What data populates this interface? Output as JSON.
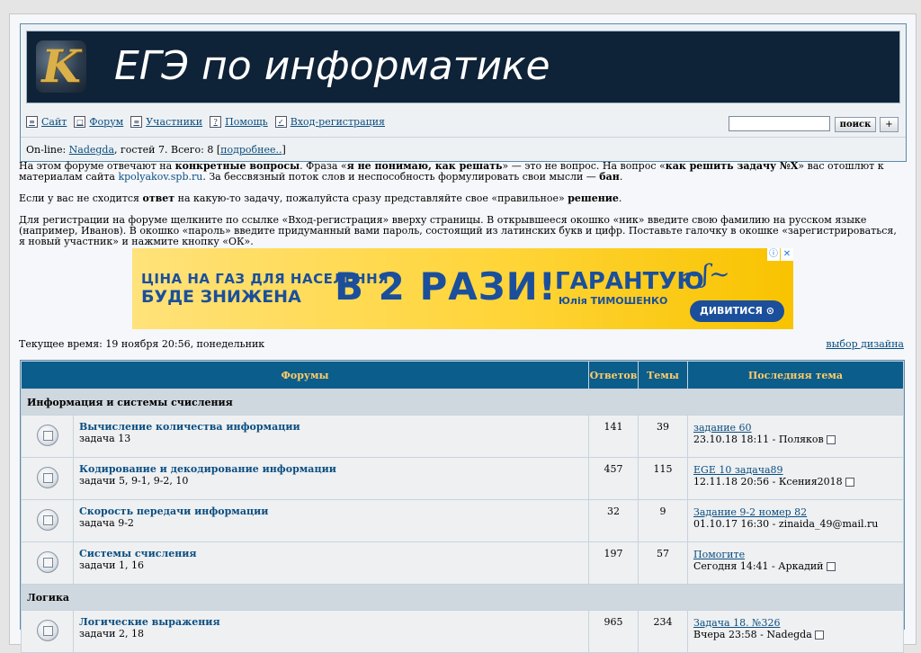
{
  "header": {
    "logo_letter": "K",
    "site_title": "ЕГЭ по информатике"
  },
  "nav": {
    "items": [
      {
        "label": "Сайт",
        "icon": "site-icon"
      },
      {
        "label": "Форум",
        "icon": "forum-icon"
      },
      {
        "label": "Участники",
        "icon": "members-icon"
      },
      {
        "label": "Помощь",
        "icon": "help-icon"
      },
      {
        "label": "Вход-регистрация",
        "icon": "login-icon"
      }
    ],
    "search_button": "поиск",
    "plus_button": "+"
  },
  "online": {
    "prefix": "On-line: ",
    "user": "Nadegda",
    "rest": ", гостей 7. Всего: 8 [",
    "more_link": "подробнее..",
    "suffix": "]"
  },
  "info": {
    "p1": [
      {
        "t": "На этом форуме отвечают на ",
        "s": "n"
      },
      {
        "t": "конкретные вопросы",
        "s": "b"
      },
      {
        "t": ". Фраза «",
        "s": "n"
      },
      {
        "t": "я не понимаю, как решать",
        "s": "b"
      },
      {
        "t": "» — это не вопрос. На вопрос «",
        "s": "n"
      },
      {
        "t": "как решить задачу №X",
        "s": "b"
      },
      {
        "t": "» вас отошлют к материалам сайта ",
        "s": "n"
      },
      {
        "t": "kpolyakov.spb.ru",
        "s": "l"
      },
      {
        "t": ". За бессвязный поток слов и неспособность формулировать свои мысли — ",
        "s": "n"
      },
      {
        "t": "бан",
        "s": "b"
      },
      {
        "t": ".",
        "s": "n"
      }
    ],
    "p2": [
      {
        "t": "Если у вас не сходится ",
        "s": "n"
      },
      {
        "t": "ответ",
        "s": "b"
      },
      {
        "t": " на какую-то задачу, пожалуйста сразу представляйте свое «правильное» ",
        "s": "n"
      },
      {
        "t": "решение",
        "s": "b"
      },
      {
        "t": ".",
        "s": "n"
      }
    ],
    "p3": "Для регистрации на форуме щелкните по ссылке «Вход-регистрация» вверху страницы. В открывшееся окошко «ник» введите свою фамилию на русском языке (например, Иванов). В окошко «пароль» введите придуманный вами пароль, состоящий из латинских букв и цифр. Поставьте галочку в окошке «зарегистрироваться, я новый участник» и нажмите кнопку «ОК»."
  },
  "ad": {
    "line1": "ЦІНА НА ГАЗ ДЛЯ НАСЕЛЕННЯ",
    "line2": "БУДЕ ЗНИЖЕНА",
    "big": "В 2 РАЗИ!",
    "guarantee": "ГАРАНТУЮ",
    "name": "Юлія ТИМОШЕНКО",
    "button": "ДИВИТИСЯ ⊙",
    "info_icon": "ⓘ",
    "close_icon": "✕",
    "colors": {
      "bg": "#ffd53a",
      "text": "#1b4f9c"
    }
  },
  "time_line": "Текущее время: 19 ноября 20:56, понедельник",
  "design_link": "выбор дизайна",
  "table": {
    "headers": {
      "forums": "Форумы",
      "replies": "Ответов",
      "topics": "Темы",
      "last": "Последняя тема"
    },
    "categories": [
      {
        "name": "Информация и системы счисления",
        "forums": [
          {
            "name": "Вычисление количества информации",
            "desc": "задача 13",
            "replies": "141",
            "topics": "39",
            "last_title": "задание 60",
            "last_meta": "23.10.18 18:11 - Поляков",
            "has_icon": true
          },
          {
            "name": "Кодирование и декодирование информации",
            "desc": "задачи 5, 9-1, 9-2, 10",
            "replies": "457",
            "topics": "115",
            "last_title": "EGE 10 задача89",
            "last_meta": "12.11.18 20:56 - Ксения2018",
            "has_icon": true
          },
          {
            "name": "Скорость передачи информации",
            "desc": "задача 9-2",
            "replies": "32",
            "topics": "9",
            "last_title": "Задание 9-2 номер 82",
            "last_meta": "01.10.17 16:30 - zinaida_49@mail.ru",
            "has_icon": false
          },
          {
            "name": "Системы счисления",
            "desc": "задачи 1, 16",
            "replies": "197",
            "topics": "57",
            "last_title": "Помогите",
            "last_meta": "Сегодня 14:41 - Аркадий",
            "has_icon": true
          }
        ]
      },
      {
        "name": "Логика",
        "forums": [
          {
            "name": "Логические выражения",
            "desc": "задачи 2, 18",
            "replies": "965",
            "topics": "234",
            "last_title": "Задача 18. №326",
            "last_meta": "Вчера 23:58 - Nadegda",
            "has_icon": true
          }
        ]
      }
    ]
  }
}
